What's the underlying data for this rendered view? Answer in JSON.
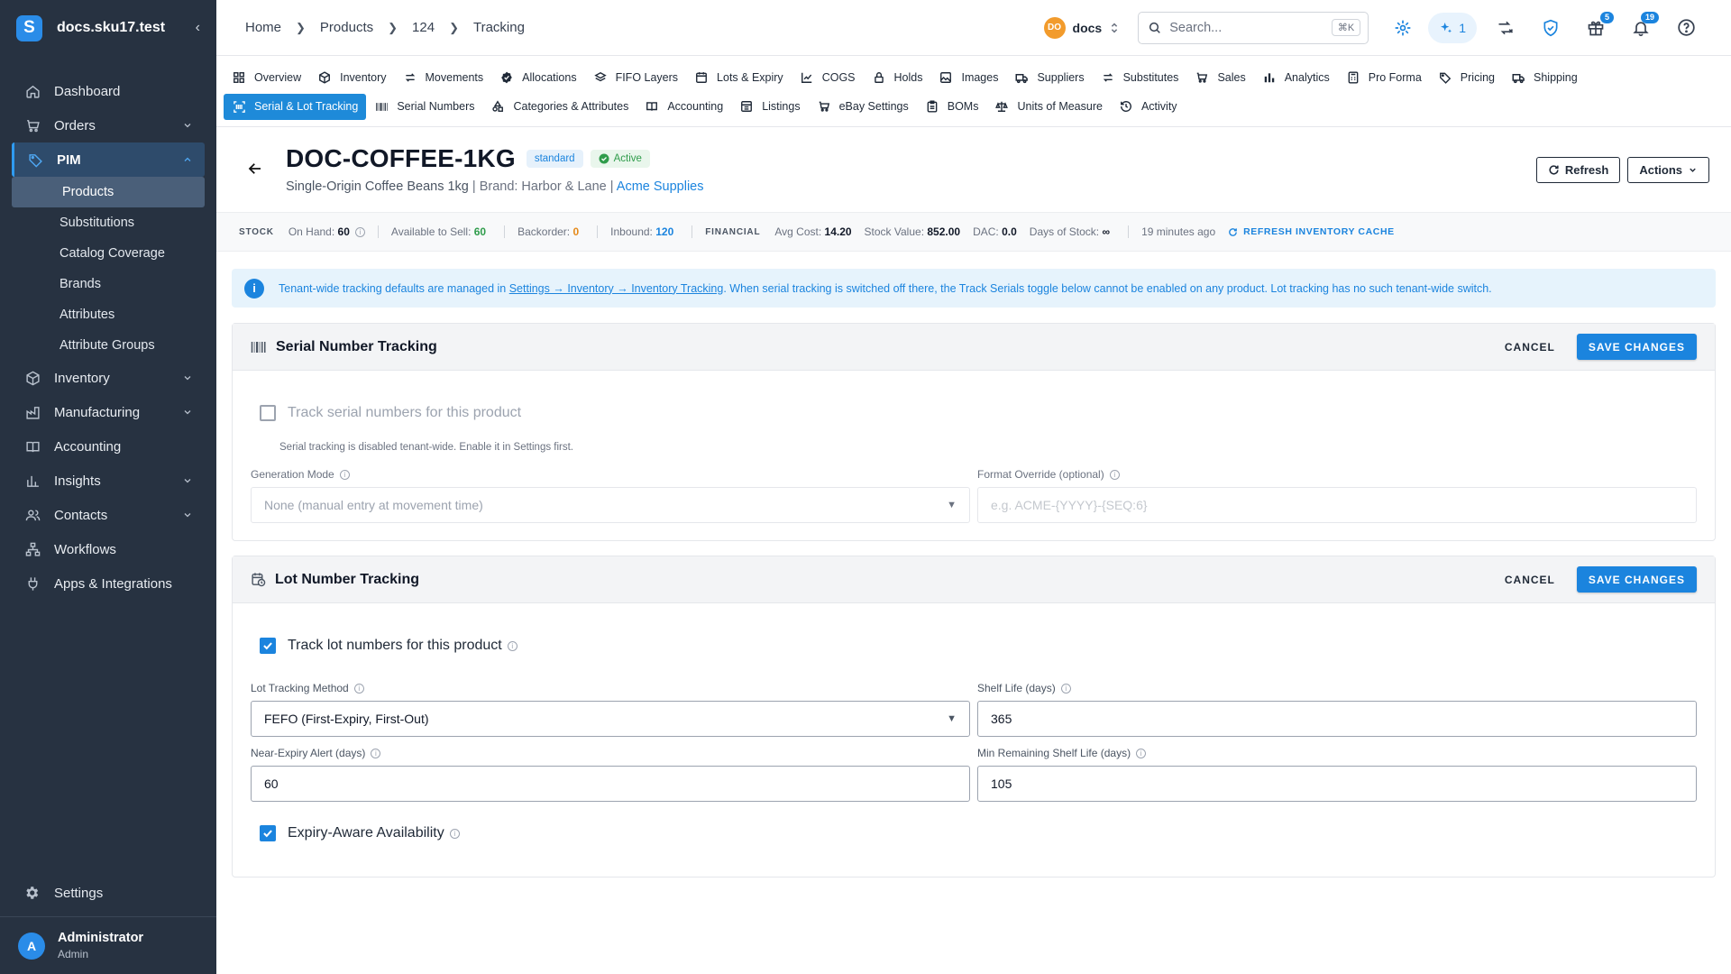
{
  "app": {
    "title": "docs.sku17.test",
    "logo_letter": "S"
  },
  "sidebar": {
    "items": [
      {
        "label": "Dashboard",
        "icon": "home-icon"
      },
      {
        "label": "Orders",
        "icon": "cart-icon",
        "expandable": true
      },
      {
        "label": "PIM",
        "icon": "tag-icon",
        "expanded": true,
        "active": true
      },
      {
        "label": "Inventory",
        "icon": "box-icon",
        "expandable": true
      },
      {
        "label": "Manufacturing",
        "icon": "factory-icon",
        "expandable": true
      },
      {
        "label": "Accounting",
        "icon": "book-icon"
      },
      {
        "label": "Insights",
        "icon": "chart-icon",
        "expandable": true
      },
      {
        "label": "Contacts",
        "icon": "people-icon",
        "expandable": true
      },
      {
        "label": "Workflows",
        "icon": "workflow-icon"
      },
      {
        "label": "Apps & Integrations",
        "icon": "plug-icon"
      }
    ],
    "pim_sub": [
      "Products",
      "Substitutions",
      "Catalog Coverage",
      "Brands",
      "Attributes",
      "Attribute Groups"
    ],
    "settings_label": "Settings",
    "user": {
      "initial": "A",
      "name": "Administrator",
      "role": "Admin"
    }
  },
  "header": {
    "breadcrumbs": [
      "Home",
      "Products",
      "124",
      "Tracking"
    ],
    "workspace": {
      "initials": "DO",
      "name": "docs"
    },
    "search": {
      "placeholder": "Search...",
      "shortcut": "⌘K"
    },
    "ai_count": "1",
    "gift_badge": "5",
    "notifications_badge": "19"
  },
  "tabs": {
    "row1": [
      "Overview",
      "Inventory",
      "Movements",
      "Allocations",
      "FIFO Layers",
      "Lots & Expiry",
      "COGS",
      "Holds",
      "Images",
      "Suppliers",
      "Substitutes",
      "Sales",
      "Analytics",
      "Pro Forma",
      "Pricing",
      "Shipping"
    ],
    "row2": [
      "Serial & Lot Tracking",
      "Serial Numbers",
      "Categories & Attributes",
      "Accounting",
      "Listings",
      "eBay Settings",
      "BOMs",
      "Units of Measure",
      "Activity"
    ],
    "active": "Serial & Lot Tracking"
  },
  "product": {
    "sku": "DOC-COFFEE-1KG",
    "type_tag": "standard",
    "status_tag": "Active",
    "name": "Single-Origin Coffee Beans 1kg",
    "brand": "Brand: Harbor & Lane",
    "supplier": "Acme Supplies",
    "refresh_label": "Refresh",
    "actions_label": "Actions"
  },
  "stock": {
    "stock_label": "STOCK",
    "on_hand_label": "On Hand:",
    "on_hand": "60",
    "available_label": "Available to Sell:",
    "available": "60",
    "backorder_label": "Backorder:",
    "backorder": "0",
    "inbound_label": "Inbound:",
    "inbound": "120",
    "financial_label": "FINANCIAL",
    "avg_cost_label": "Avg Cost:",
    "avg_cost": "14.20",
    "stock_value_label": "Stock Value:",
    "stock_value": "852.00",
    "dac_label": "DAC:",
    "dac": "0.0",
    "days_label": "Days of Stock:",
    "days": "∞",
    "updated": "19 minutes ago",
    "refresh_cache": "REFRESH INVENTORY CACHE"
  },
  "alert": {
    "prefix": "Tenant-wide tracking defaults are managed in ",
    "link": "Settings → Inventory → Inventory Tracking",
    "suffix": ". When serial tracking is switched off there, the Track Serials toggle below cannot be enabled on any product. Lot tracking has no such tenant-wide switch."
  },
  "serial": {
    "title": "Serial Number Tracking",
    "cancel": "CANCEL",
    "save": "SAVE CHANGES",
    "track_label": "Track serial numbers for this product",
    "track_checked": false,
    "helper": "Serial tracking is disabled tenant-wide. Enable it in Settings first.",
    "generation_mode_label": "Generation Mode",
    "generation_mode_value": "None (manual entry at movement time)",
    "format_label": "Format Override (optional)",
    "format_placeholder": "e.g. ACME-{YYYY}-{SEQ:6}"
  },
  "lot": {
    "title": "Lot Number Tracking",
    "cancel": "CANCEL",
    "save": "SAVE CHANGES",
    "track_label": "Track lot numbers for this product",
    "track_checked": true,
    "method_label": "Lot Tracking Method",
    "method_value": "FEFO (First-Expiry, First-Out)",
    "shelf_life_label": "Shelf Life (days)",
    "shelf_life_value": "365",
    "near_expiry_label": "Near-Expiry Alert (days)",
    "near_expiry_value": "60",
    "min_remaining_label": "Min Remaining Shelf Life (days)",
    "min_remaining_value": "105",
    "expiry_aware_label": "Expiry-Aware Availability",
    "expiry_aware_checked": true
  },
  "colors": {
    "accent": "#1b84de",
    "sidebar_bg": "#273241",
    "success": "#2f9c4b",
    "warning": "#e58a1a"
  }
}
